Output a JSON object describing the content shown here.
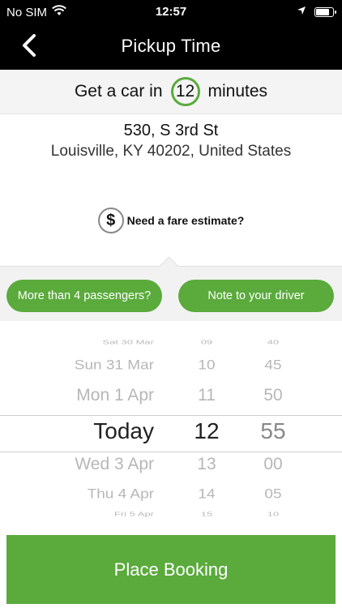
{
  "status_bar": {
    "carrier": "No SIM",
    "time": "12:57",
    "battery_level": 0.85
  },
  "header": {
    "title": "Pickup Time"
  },
  "eta": {
    "prefix": "Get a car in",
    "minutes": "12",
    "suffix": "minutes"
  },
  "address": {
    "line1": "530, S 3rd St",
    "line2": "Louisville, KY  40202, United States"
  },
  "fare": {
    "label": "Need a fare estimate?"
  },
  "options": {
    "passengers_label": "More than 4 passengers?",
    "note_label": "Note to your driver"
  },
  "picker": {
    "rows": [
      {
        "date": "Sat 30 Mar",
        "hour": "09",
        "minute": "40"
      },
      {
        "date": "Sun 31 Mar",
        "hour": "10",
        "minute": "45"
      },
      {
        "date": "Mon 1 Apr",
        "hour": "11",
        "minute": "50"
      },
      {
        "date": "Today",
        "hour": "12",
        "minute": "55"
      },
      {
        "date": "Wed 3 Apr",
        "hour": "13",
        "minute": "00"
      },
      {
        "date": "Thu 4 Apr",
        "hour": "14",
        "minute": "05"
      },
      {
        "date": "Fri 5 Apr",
        "hour": "15",
        "minute": "10"
      }
    ]
  },
  "booking": {
    "label": "Place Booking"
  },
  "colors": {
    "accent": "#5aaa3c",
    "header_bg": "#000000"
  }
}
